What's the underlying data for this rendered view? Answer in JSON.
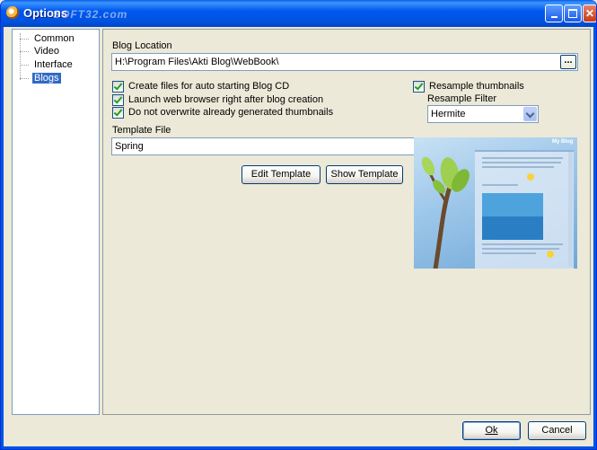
{
  "window": {
    "title": "Options",
    "watermark": "SOFT32.com"
  },
  "tree": {
    "items": [
      "Common",
      "Video",
      "Interface",
      "Blogs"
    ],
    "selected": "Blogs"
  },
  "blog_location": {
    "label": "Blog Location",
    "value": "H:\\Program Files\\Akti Blog\\WebBook\\",
    "browse": "..."
  },
  "checkboxes": {
    "auto_start": {
      "label": "Create files for auto starting Blog CD",
      "checked": true
    },
    "launch_browser": {
      "label": "Launch web browser right after blog creation",
      "checked": true
    },
    "no_overwrite": {
      "label": "Do not overwrite already generated thumbnails",
      "checked": true
    },
    "resample": {
      "label": "Resample thumbnails",
      "checked": true
    }
  },
  "resample_filter": {
    "label": "Resample Filter",
    "value": "Hermite"
  },
  "template": {
    "label": "Template File",
    "value": "Spring",
    "edit": "Edit Template",
    "show": "Show Template"
  },
  "preview": {
    "blog_title": "My Blog"
  },
  "footer": {
    "ok": "Ok",
    "cancel": "Cancel"
  }
}
